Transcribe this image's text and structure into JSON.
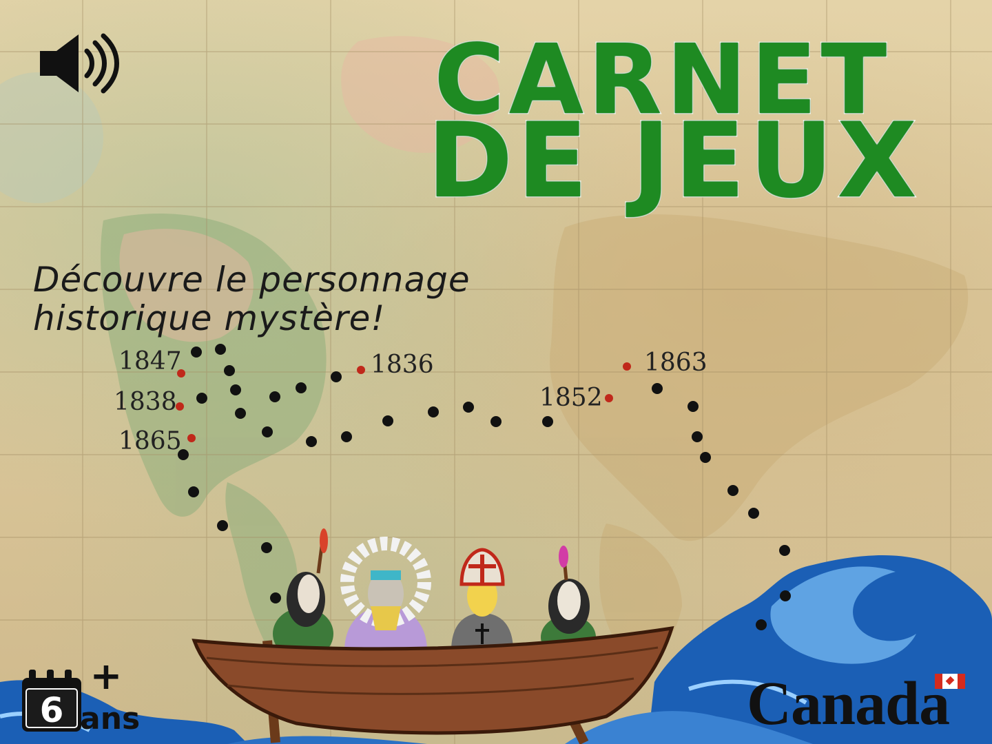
{
  "title": {
    "line1": "CARNET",
    "line2": "DE JEUX"
  },
  "subtitle": {
    "line1": "Découvre le personnage",
    "line2": "historique mystère!"
  },
  "years": [
    "1847",
    "1838",
    "1865",
    "1836",
    "1852",
    "1863"
  ],
  "age_badge": {
    "number": "6",
    "suffix": "ans",
    "plus": "+"
  },
  "logo": {
    "wordmark": "Canada"
  },
  "icons": [
    "speaker-icon",
    "calendar-icon",
    "canada-flag-icon"
  ],
  "colors": {
    "title_green": "#1e8a22",
    "dot_black": "#111111",
    "dot_red": "#c0281a",
    "sea_blue": "#1b5fb5"
  }
}
